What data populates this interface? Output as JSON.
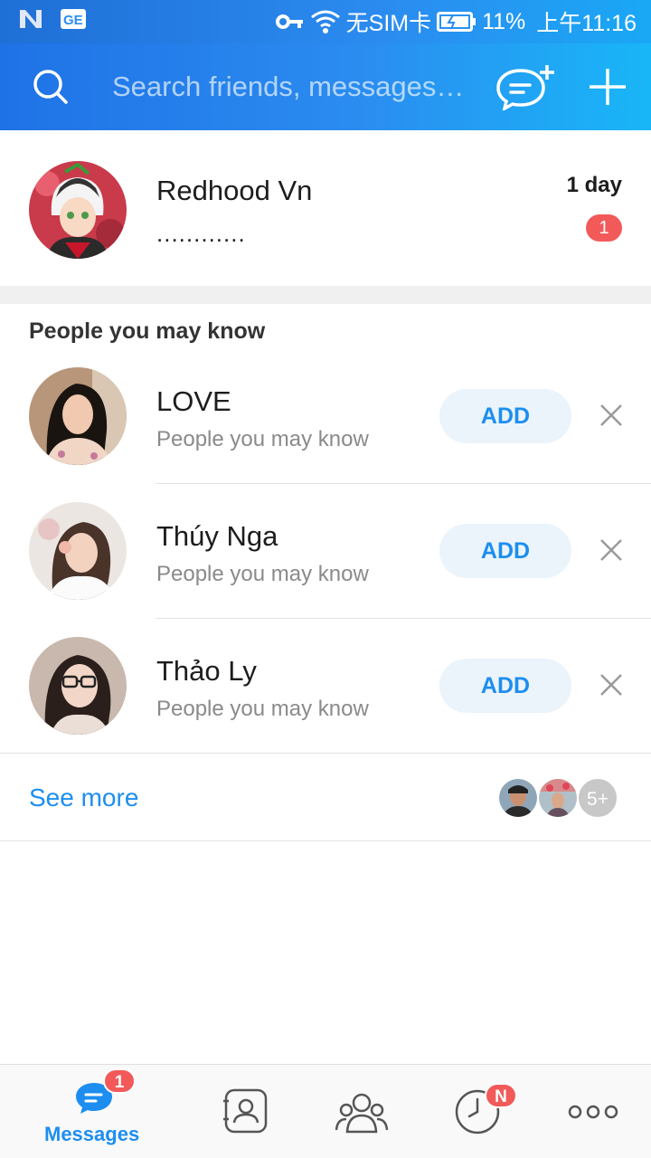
{
  "status_bar": {
    "sim": "无SIM卡",
    "battery": "11%",
    "time": "上午11:16"
  },
  "header": {
    "search_placeholder": "Search friends, messages…"
  },
  "conversation": {
    "name": "Redhood Vn",
    "preview": "............",
    "time": "1 day",
    "unread": "1"
  },
  "suggestions": {
    "title": "People you may know",
    "items": [
      {
        "name": "LOVE",
        "subtitle": "People you may know",
        "action": "ADD"
      },
      {
        "name": "Thúy Nga",
        "subtitle": "People you may know",
        "action": "ADD"
      },
      {
        "name": "Thảo Ly",
        "subtitle": "People you may know",
        "action": "ADD"
      }
    ],
    "see_more": "See more",
    "more_count": "5+"
  },
  "bottom_nav": {
    "messages_label": "Messages",
    "messages_badge": "1",
    "timeline_badge": "N"
  },
  "colors": {
    "accent": "#1d8ef0",
    "badge": "#f25a5a",
    "header_gradient_start": "#1f72e6",
    "header_gradient_end": "#19b6f7"
  }
}
